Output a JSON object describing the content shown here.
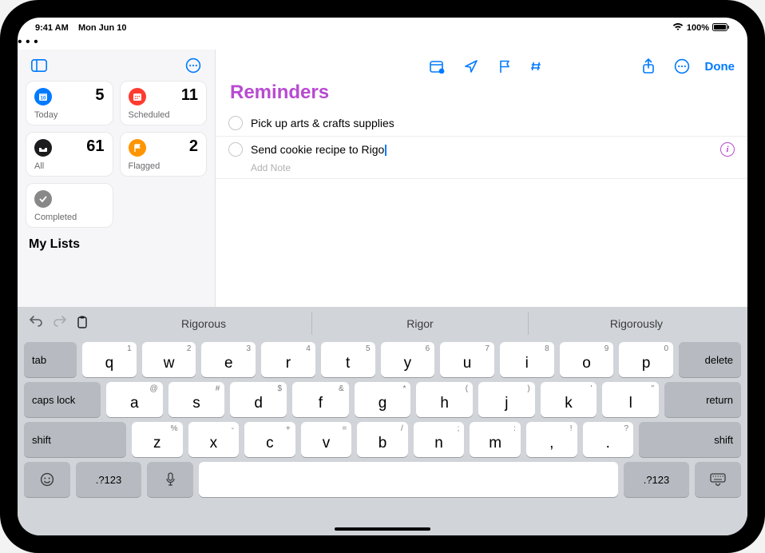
{
  "status": {
    "time": "9:41 AM",
    "date": "Mon Jun 10",
    "batt": "100%"
  },
  "sidebar": {
    "cards": {
      "today": {
        "label": "Today",
        "count": "5"
      },
      "sched": {
        "label": "Scheduled",
        "count": "11"
      },
      "all": {
        "label": "All",
        "count": "61"
      },
      "flag": {
        "label": "Flagged",
        "count": "2"
      },
      "comp": {
        "label": "Completed"
      }
    },
    "mylists": "My Lists"
  },
  "main": {
    "title": "Reminders",
    "done": "Done",
    "items": [
      {
        "text": "Pick up arts & crafts supplies"
      },
      {
        "text": "Send cookie recipe to Rigo"
      }
    ],
    "addnote": "Add Note"
  },
  "keyboard": {
    "predictions": [
      "Rigorous",
      "Rigor",
      "Rigorously"
    ],
    "row1": [
      {
        "k": "q",
        "s": "1"
      },
      {
        "k": "w",
        "s": "2"
      },
      {
        "k": "e",
        "s": "3"
      },
      {
        "k": "r",
        "s": "4"
      },
      {
        "k": "t",
        "s": "5"
      },
      {
        "k": "y",
        "s": "6"
      },
      {
        "k": "u",
        "s": "7"
      },
      {
        "k": "i",
        "s": "8"
      },
      {
        "k": "o",
        "s": "9"
      },
      {
        "k": "p",
        "s": "0"
      }
    ],
    "row2": [
      {
        "k": "a",
        "s": "@"
      },
      {
        "k": "s",
        "s": "#"
      },
      {
        "k": "d",
        "s": "$"
      },
      {
        "k": "f",
        "s": "&"
      },
      {
        "k": "g",
        "s": "*"
      },
      {
        "k": "h",
        "s": "("
      },
      {
        "k": "j",
        "s": ")"
      },
      {
        "k": "k",
        "s": "'"
      },
      {
        "k": "l",
        "s": "\""
      }
    ],
    "row3": [
      {
        "k": "z",
        "s": "%"
      },
      {
        "k": "x",
        "s": "-"
      },
      {
        "k": "c",
        "s": "+"
      },
      {
        "k": "v",
        "s": "="
      },
      {
        "k": "b",
        "s": "/"
      },
      {
        "k": "n",
        "s": ";"
      },
      {
        "k": "m",
        "s": ":"
      },
      {
        "k": ",",
        "s": "!"
      },
      {
        "k": ".",
        "s": "?"
      }
    ],
    "fn": {
      "tab": "tab",
      "delete": "delete",
      "caps": "caps lock",
      "return": "return",
      "shift": "shift",
      "mode": ".?123"
    }
  }
}
